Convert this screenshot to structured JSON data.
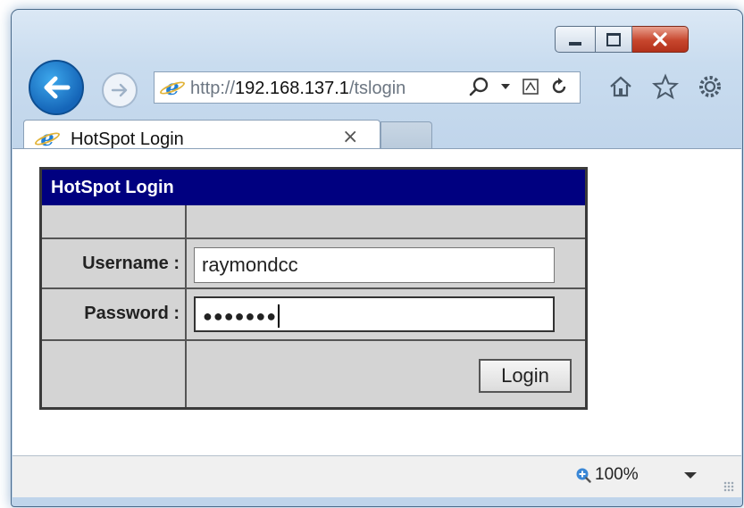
{
  "browser": {
    "url_prefix": "http://",
    "url_host": "192.168.137.1",
    "url_path": "/tslogin",
    "tab_title": "HotSpot Login",
    "tab_close": "×",
    "zoom": "100%"
  },
  "login": {
    "header": "HotSpot Login",
    "username_label": "Username :",
    "username_value": "raymondcc",
    "password_label": "Password :",
    "password_masked": "●●●●●●●",
    "button_label": "Login"
  },
  "colors": {
    "header_bg": "#000080",
    "form_bg": "#d4d4d4",
    "back_button": "#1a73c8"
  },
  "icons": {
    "back": "back-arrow-icon",
    "forward": "forward-arrow-icon",
    "ie": "internet-explorer-icon",
    "search": "search-icon",
    "compat": "compatibility-view-icon",
    "refresh": "refresh-icon",
    "home": "home-icon",
    "favorites": "star-icon",
    "tools": "gear-icon",
    "zoom": "zoom-icon"
  }
}
